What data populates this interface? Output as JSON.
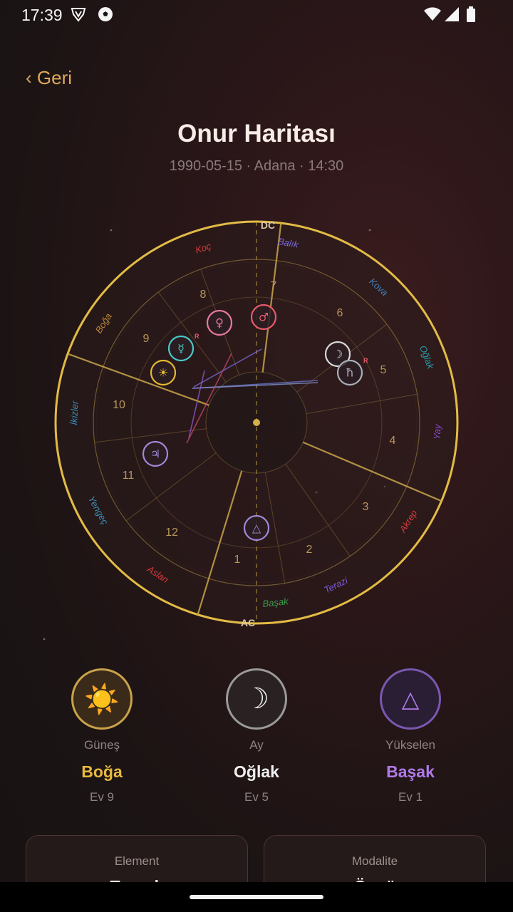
{
  "status": {
    "time": "17:39"
  },
  "header": {
    "back": "‹ Geri",
    "title": "Onur Haritası",
    "subtitle": "1990-05-15 · Adana · 14:30"
  },
  "chart": {
    "axes": {
      "top": "DC",
      "bottom": "AC"
    },
    "signs": [
      {
        "name": "Koç",
        "color": "#d43a3a"
      },
      {
        "name": "Boğa",
        "color": "#b8853a"
      },
      {
        "name": "İkizler",
        "color": "#3c8fb8"
      },
      {
        "name": "Yengeç",
        "color": "#3c8fb8"
      },
      {
        "name": "Aslan",
        "color": "#d43a3a"
      },
      {
        "name": "Başak",
        "color": "#3a9a4a"
      },
      {
        "name": "Terazi",
        "color": "#7a5ad8"
      },
      {
        "name": "Akrep",
        "color": "#d43a3a"
      },
      {
        "name": "Yay",
        "color": "#8a4ad8"
      },
      {
        "name": "Oğlak",
        "color": "#2a9aa8"
      },
      {
        "name": "Kova",
        "color": "#3c7fb8"
      },
      {
        "name": "Balık",
        "color": "#7a6ad8"
      }
    ],
    "houses": [
      "1",
      "2",
      "3",
      "4",
      "5",
      "6",
      "7",
      "8",
      "9",
      "10",
      "11",
      "12"
    ],
    "planets": [
      {
        "name": "sun",
        "glyph": "☀",
        "color": "#e6b830",
        "retro": ""
      },
      {
        "name": "mercury",
        "glyph": "☿",
        "color": "#4ac8c8",
        "retro": "R"
      },
      {
        "name": "venus",
        "glyph": "♀",
        "color": "#e87aa0",
        "retro": ""
      },
      {
        "name": "mars",
        "glyph": "♂",
        "color": "#e85a6a",
        "retro": ""
      },
      {
        "name": "moon",
        "glyph": "☽",
        "color": "#d8d8d8",
        "retro": ""
      },
      {
        "name": "saturn",
        "glyph": "ħ",
        "color": "#a8b0b8",
        "retro": "R"
      },
      {
        "name": "jupiter",
        "glyph": "♃",
        "color": "#a088d8",
        "retro": ""
      },
      {
        "name": "ascendant",
        "glyph": "△",
        "color": "#a088d8",
        "retro": ""
      }
    ]
  },
  "summary": {
    "sun": {
      "icon": "☀️",
      "label": "Güneş",
      "sign": "Boğa",
      "house": "Ev 9",
      "color": "#e6b840"
    },
    "moon": {
      "icon": "☽",
      "label": "Ay",
      "sign": "Oğlak",
      "house": "Ev 5",
      "color": "#f0f0f0"
    },
    "rising": {
      "icon": "△",
      "label": "Yükselen",
      "sign": "Başak",
      "house": "Ev 1",
      "color": "#b07ae8"
    }
  },
  "cards": {
    "element": {
      "title": "Element",
      "value": "Toprak"
    },
    "modality": {
      "title": "Modalite",
      "value": "Öncü"
    }
  }
}
